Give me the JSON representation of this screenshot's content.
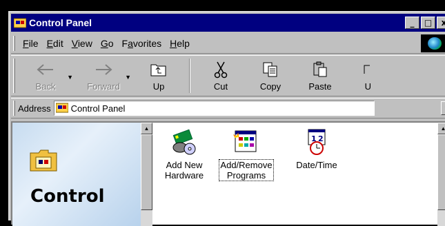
{
  "window": {
    "title": "Control Panel",
    "controls": [
      "_",
      "□",
      "x"
    ]
  },
  "menubar": {
    "items": [
      {
        "label": "File",
        "accel": "F",
        "rest": "ile"
      },
      {
        "label": "Edit",
        "accel": "E",
        "rest": "dit"
      },
      {
        "label": "View",
        "accel": "V",
        "rest": "iew"
      },
      {
        "label": "Go",
        "accel": "G",
        "rest": "o"
      },
      {
        "label": "Favorites",
        "accel": "a",
        "pre": "F",
        "rest": "vorites"
      },
      {
        "label": "Help",
        "accel": "H",
        "rest": "elp"
      }
    ]
  },
  "toolbar": {
    "back_label": "Back",
    "forward_label": "Forward",
    "up_label": "Up",
    "cut_label": "Cut",
    "copy_label": "Copy",
    "paste_label": "Paste",
    "undo_label": "U"
  },
  "address": {
    "label": "Address",
    "value": "Control Panel"
  },
  "leftpane": {
    "title": "Control"
  },
  "icons": [
    {
      "line1": "Add New",
      "line2": "Hardware"
    },
    {
      "line1": "Add/Remove",
      "line2": "Programs"
    },
    {
      "line1": "Date/Time",
      "line2": ""
    }
  ],
  "colors": {
    "titlebar": "#000080",
    "face": "#c0c0c0"
  }
}
